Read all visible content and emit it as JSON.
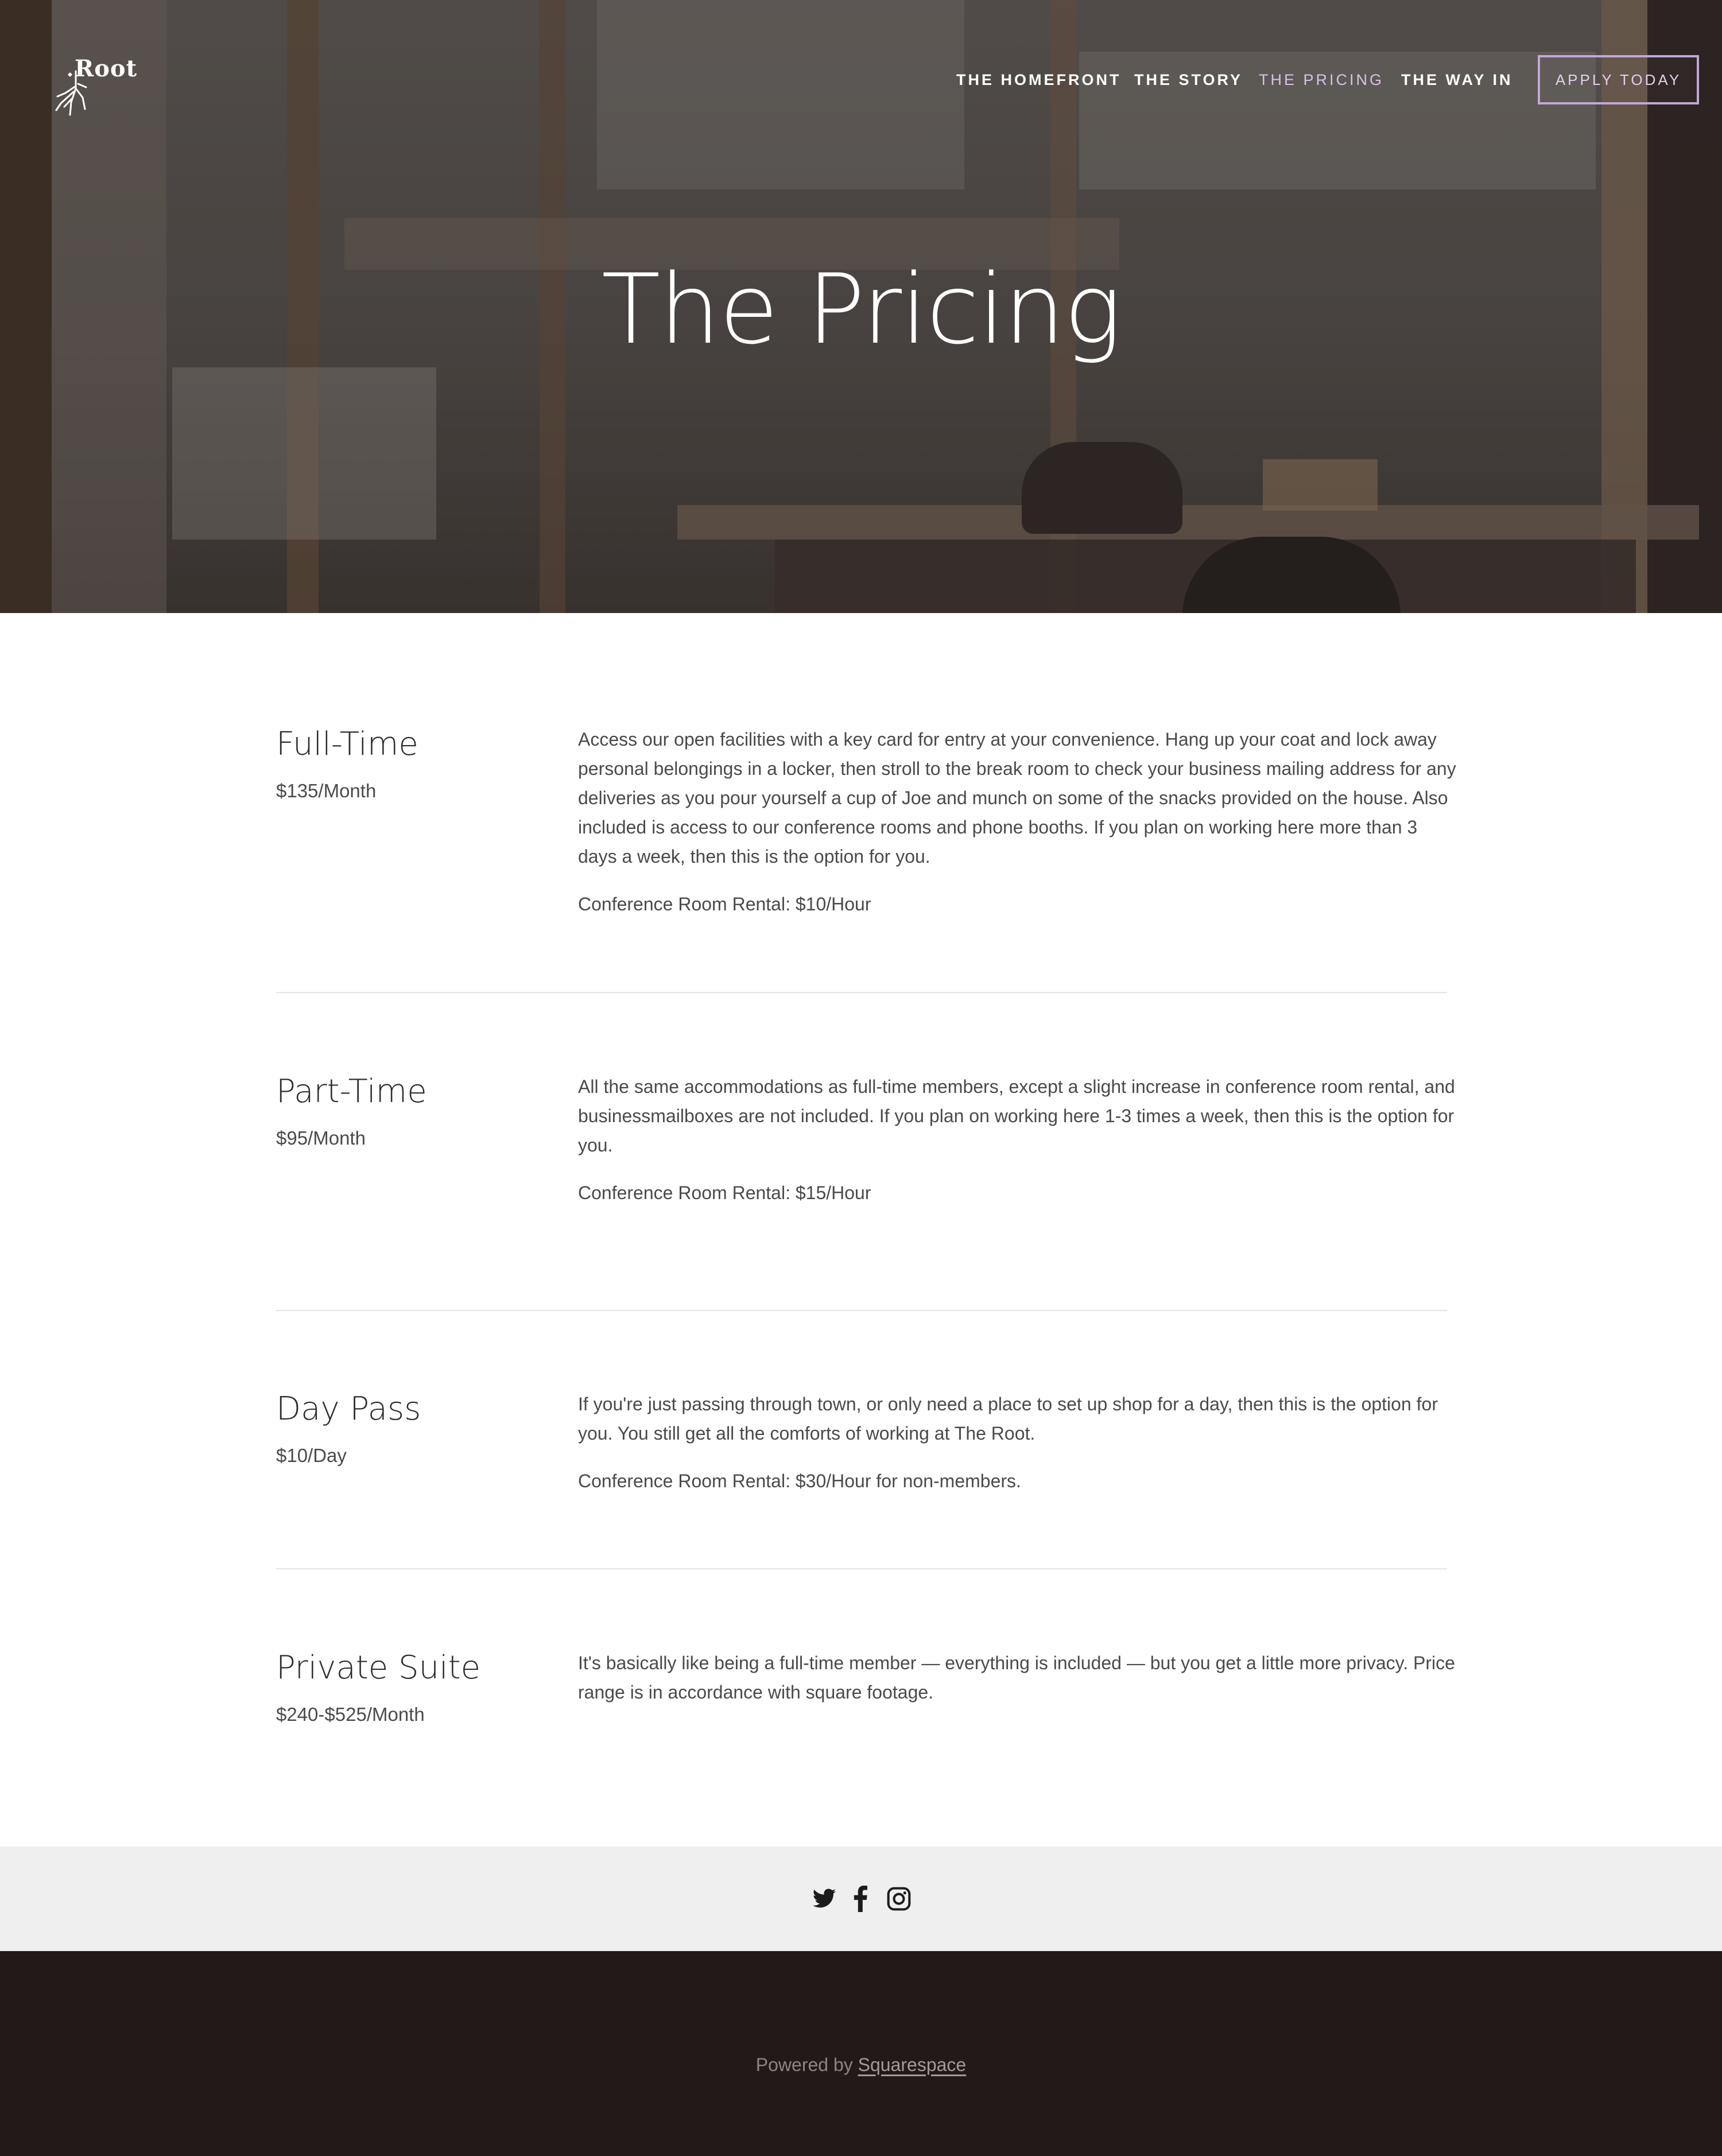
{
  "header": {
    "logo_text": "Root",
    "nav": [
      {
        "label": "THE HOMEFRONT",
        "active": false
      },
      {
        "label": "THE STORY",
        "active": false
      },
      {
        "label": "THE PRICING",
        "active": true
      },
      {
        "label": "THE WAY IN",
        "active": false
      }
    ],
    "cta_label": "APPLY TODAY"
  },
  "hero": {
    "title": "The Pricing"
  },
  "plans": [
    {
      "name": "Full-Time",
      "price": "$135/Month",
      "description": "Access our open facilities with a key card for entry at your convenience. Hang up your coat and lock away personal belongings in a locker, then stroll to the break room to check your business mailing address for any deliveries as you pour yourself a cup of Joe and munch on some of the snacks provided on the house. Also included is access to our conference rooms and phone booths. If you plan on working here more than 3 days a week, then this is the option for you.",
      "rental": "Conference Room Rental: $10/Hour"
    },
    {
      "name": "Part-Time",
      "price": "$95/Month",
      "description": "All the same accommodations as full-time members, except a slight increase in conference room rental, and businessmailboxes are not included. If you plan on working here 1-3 times a week, then this is the option for you.",
      "rental": "Conference Room Rental: $15/Hour"
    },
    {
      "name": "Day Pass",
      "price": "$10/Day",
      "description": "If you're just passing through town, or only need a place to set up shop for a day, then this is the option for you. You still get all the comforts of working at The Root.",
      "rental": "Conference Room Rental: $30/Hour for non-members."
    },
    {
      "name": "Private Suite",
      "price": "$240-$525/Month",
      "description": "It's basically like being a full-time member — everything is included — but you get a little more privacy. Price range is in accordance with square footage.",
      "rental": ""
    }
  ],
  "social": {
    "icons": [
      "twitter-icon",
      "facebook-icon",
      "instagram-icon"
    ]
  },
  "footer": {
    "powered_prefix": "Powered by",
    "powered_link": "Squarespace"
  },
  "colors": {
    "accent": "#c5a6da",
    "footer_bg": "#211a19",
    "social_bg": "#efefef"
  }
}
